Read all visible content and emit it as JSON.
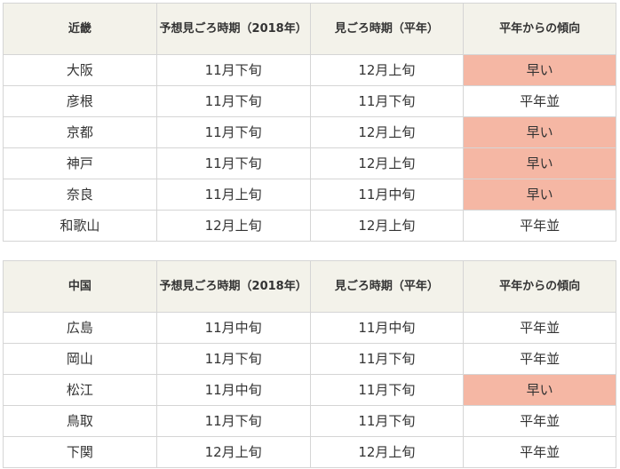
{
  "tables": [
    {
      "headers": [
        "近畿",
        "予想見ごろ時期（2018年）",
        "見ごろ時期（平年）",
        "平年からの傾向"
      ],
      "rows": [
        {
          "place": "大阪",
          "forecast": "11月下旬",
          "normal": "12月上旬",
          "trend": "早い",
          "highlight": true
        },
        {
          "place": "彦根",
          "forecast": "11月下旬",
          "normal": "11月下旬",
          "trend": "平年並",
          "highlight": false
        },
        {
          "place": "京都",
          "forecast": "11月下旬",
          "normal": "12月上旬",
          "trend": "早い",
          "highlight": true
        },
        {
          "place": "神戸",
          "forecast": "11月下旬",
          "normal": "12月上旬",
          "trend": "早い",
          "highlight": true
        },
        {
          "place": "奈良",
          "forecast": "11月上旬",
          "normal": "11月中旬",
          "trend": "早い",
          "highlight": true
        },
        {
          "place": "和歌山",
          "forecast": "12月上旬",
          "normal": "12月上旬",
          "trend": "平年並",
          "highlight": false
        }
      ]
    },
    {
      "headers": [
        "中国",
        "予想見ごろ時期（2018年）",
        "見ごろ時期（平年）",
        "平年からの傾向"
      ],
      "rows": [
        {
          "place": "広島",
          "forecast": "11月中旬",
          "normal": "11月中旬",
          "trend": "平年並",
          "highlight": false
        },
        {
          "place": "岡山",
          "forecast": "11月下旬",
          "normal": "11月下旬",
          "trend": "平年並",
          "highlight": false
        },
        {
          "place": "松江",
          "forecast": "11月中旬",
          "normal": "11月下旬",
          "trend": "早い",
          "highlight": true
        },
        {
          "place": "鳥取",
          "forecast": "11月下旬",
          "normal": "11月下旬",
          "trend": "平年並",
          "highlight": false
        },
        {
          "place": "下関",
          "forecast": "12月上旬",
          "normal": "12月上旬",
          "trend": "平年並",
          "highlight": false
        }
      ]
    }
  ],
  "colors": {
    "highlight": "#f5b7a4",
    "header_bg": "#f3f2ea",
    "border": "#d5d5d5"
  }
}
